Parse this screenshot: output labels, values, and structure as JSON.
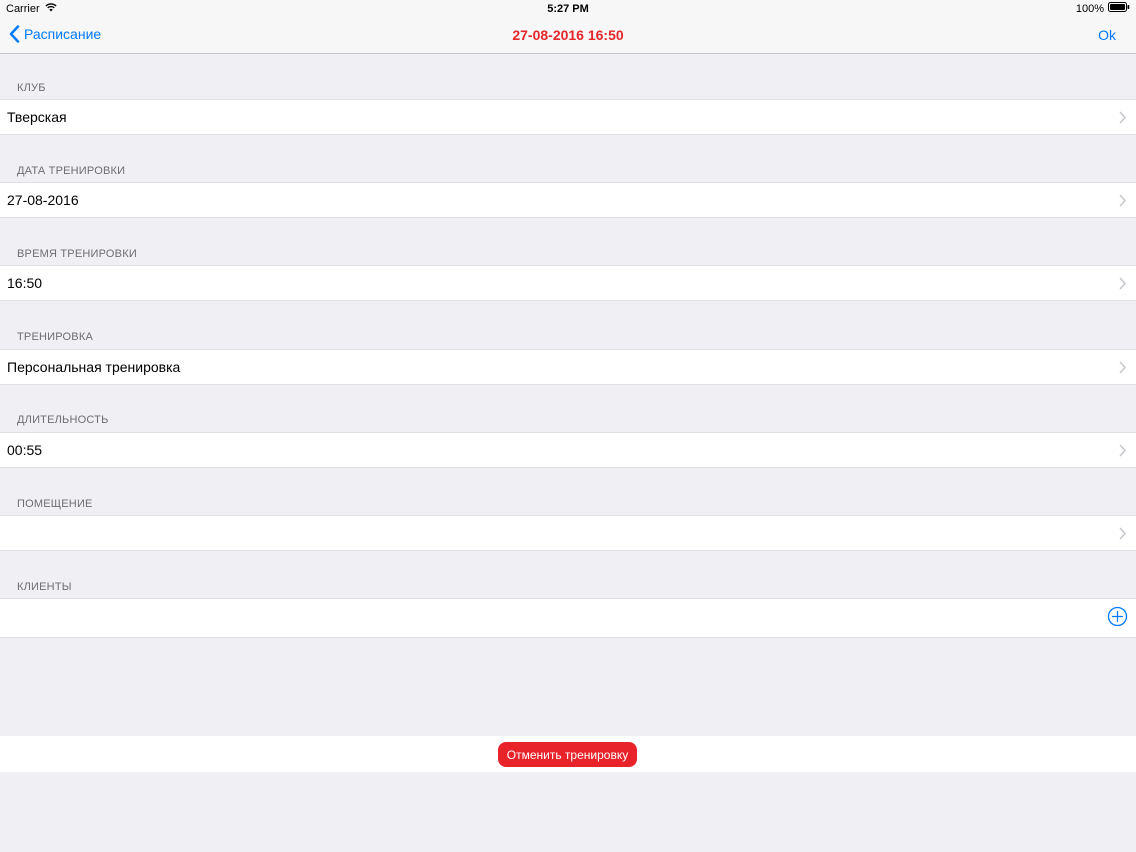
{
  "status_bar": {
    "carrier": "Carrier",
    "time": "5:27 PM",
    "battery": "100%"
  },
  "nav": {
    "back_label": "Расписание",
    "title": "27-08-2016 16:50",
    "ok_label": "Ok"
  },
  "sections": [
    {
      "header": "КЛУБ",
      "value": "Тверская"
    },
    {
      "header": "ДАТА ТРЕНИРОВКИ",
      "value": "27-08-2016"
    },
    {
      "header": "ВРЕМЯ ТРЕНИРОВКИ",
      "value": "16:50"
    },
    {
      "header": "ТРЕНИРОВКА",
      "value": "Персональная тренировка"
    },
    {
      "header": "ДЛИТЕЛЬНОСТЬ",
      "value": "00:55"
    },
    {
      "header": "ПОМЕЩЕНИЕ",
      "value": ""
    },
    {
      "header": "КЛИЕНТЫ",
      "value": ""
    }
  ],
  "footer": {
    "cancel_label": "Отменить тренировку"
  },
  "colors": {
    "accent": "#007aff",
    "title_red": "#e5262a",
    "button_red": "#e8232a",
    "background": "#efeff4"
  },
  "icons": {
    "back": "chevron-left-icon",
    "row": "chevron-right-icon",
    "add": "plus-circle-icon",
    "wifi": "wifi-icon",
    "battery": "battery-icon"
  }
}
